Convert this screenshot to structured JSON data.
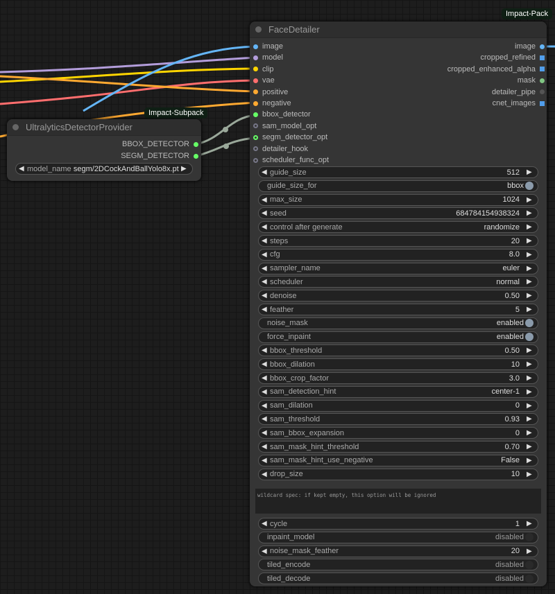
{
  "badges": {
    "impact_pack": "Impact-Pack",
    "impact_subpack": "Impact-Subpack"
  },
  "face_detailer": {
    "title": "FaceDetailer",
    "inputs": [
      {
        "label": "image",
        "color": "#64b5f6"
      },
      {
        "label": "model",
        "color": "#b39ddb"
      },
      {
        "label": "clip",
        "color": "#ffd500"
      },
      {
        "label": "vae",
        "color": "#ff6e6e"
      },
      {
        "label": "positive",
        "color": "#ffa931"
      },
      {
        "label": "negative",
        "color": "#ffa931"
      },
      {
        "label": "bbox_detector",
        "color": "#6f6"
      },
      {
        "label": "sam_model_opt",
        "color": "hollow"
      },
      {
        "label": "segm_detector_opt",
        "color": "hollow-green"
      },
      {
        "label": "detailer_hook",
        "color": "hollow"
      },
      {
        "label": "scheduler_func_opt",
        "color": "hollow"
      }
    ],
    "outputs": [
      {
        "label": "image",
        "color": "#64b5f6"
      },
      {
        "label": "cropped_refined",
        "color": "grid"
      },
      {
        "label": "cropped_enhanced_alpha",
        "color": "grid"
      },
      {
        "label": "mask",
        "color": "#81c784"
      },
      {
        "label": "detailer_pipe",
        "color": "#555"
      },
      {
        "label": "cnet_images",
        "color": "grid"
      }
    ],
    "widgets": [
      {
        "label": "guide_size",
        "value": "512",
        "type": "number"
      },
      {
        "label": "guide_size_for",
        "value": "bbox",
        "type": "toggle",
        "on": true
      },
      {
        "label": "max_size",
        "value": "1024",
        "type": "number"
      },
      {
        "label": "seed",
        "value": "684784154938324",
        "type": "number"
      },
      {
        "label": "control after generate",
        "value": "randomize",
        "type": "number"
      },
      {
        "label": "steps",
        "value": "20",
        "type": "number"
      },
      {
        "label": "cfg",
        "value": "8.0",
        "type": "number"
      },
      {
        "label": "sampler_name",
        "value": "euler",
        "type": "number"
      },
      {
        "label": "scheduler",
        "value": "normal",
        "type": "number"
      },
      {
        "label": "denoise",
        "value": "0.50",
        "type": "number"
      },
      {
        "label": "feather",
        "value": "5",
        "type": "number"
      },
      {
        "label": "noise_mask",
        "value": "enabled",
        "type": "toggle",
        "on": true
      },
      {
        "label": "force_inpaint",
        "value": "enabled",
        "type": "toggle",
        "on": true
      },
      {
        "label": "bbox_threshold",
        "value": "0.50",
        "type": "number"
      },
      {
        "label": "bbox_dilation",
        "value": "10",
        "type": "number"
      },
      {
        "label": "bbox_crop_factor",
        "value": "3.0",
        "type": "number"
      },
      {
        "label": "sam_detection_hint",
        "value": "center-1",
        "type": "number"
      },
      {
        "label": "sam_dilation",
        "value": "0",
        "type": "number"
      },
      {
        "label": "sam_threshold",
        "value": "0.93",
        "type": "number"
      },
      {
        "label": "sam_bbox_expansion",
        "value": "0",
        "type": "number"
      },
      {
        "label": "sam_mask_hint_threshold",
        "value": "0.70",
        "type": "number"
      },
      {
        "label": "sam_mask_hint_use_negative",
        "value": "False",
        "type": "number"
      },
      {
        "label": "drop_size",
        "value": "10",
        "type": "number"
      }
    ],
    "wildcard_placeholder": "wildcard spec: if kept empty, this option will be ignored",
    "widgets2": [
      {
        "label": "cycle",
        "value": "1",
        "type": "number"
      },
      {
        "label": "inpaint_model",
        "value": "disabled",
        "type": "toggle",
        "on": false
      },
      {
        "label": "noise_mask_feather",
        "value": "20",
        "type": "number"
      },
      {
        "label": "tiled_encode",
        "value": "disabled",
        "type": "toggle",
        "on": false
      },
      {
        "label": "tiled_decode",
        "value": "disabled",
        "type": "toggle",
        "on": false
      }
    ]
  },
  "detector_provider": {
    "title": "UltralyticsDetectorProvider",
    "outputs": [
      "BBOX_DETECTOR",
      "SEGM_DETECTOR"
    ],
    "model_label": "model_name",
    "model_value": "segm/2DCockAndBallYolo8x.pt"
  }
}
